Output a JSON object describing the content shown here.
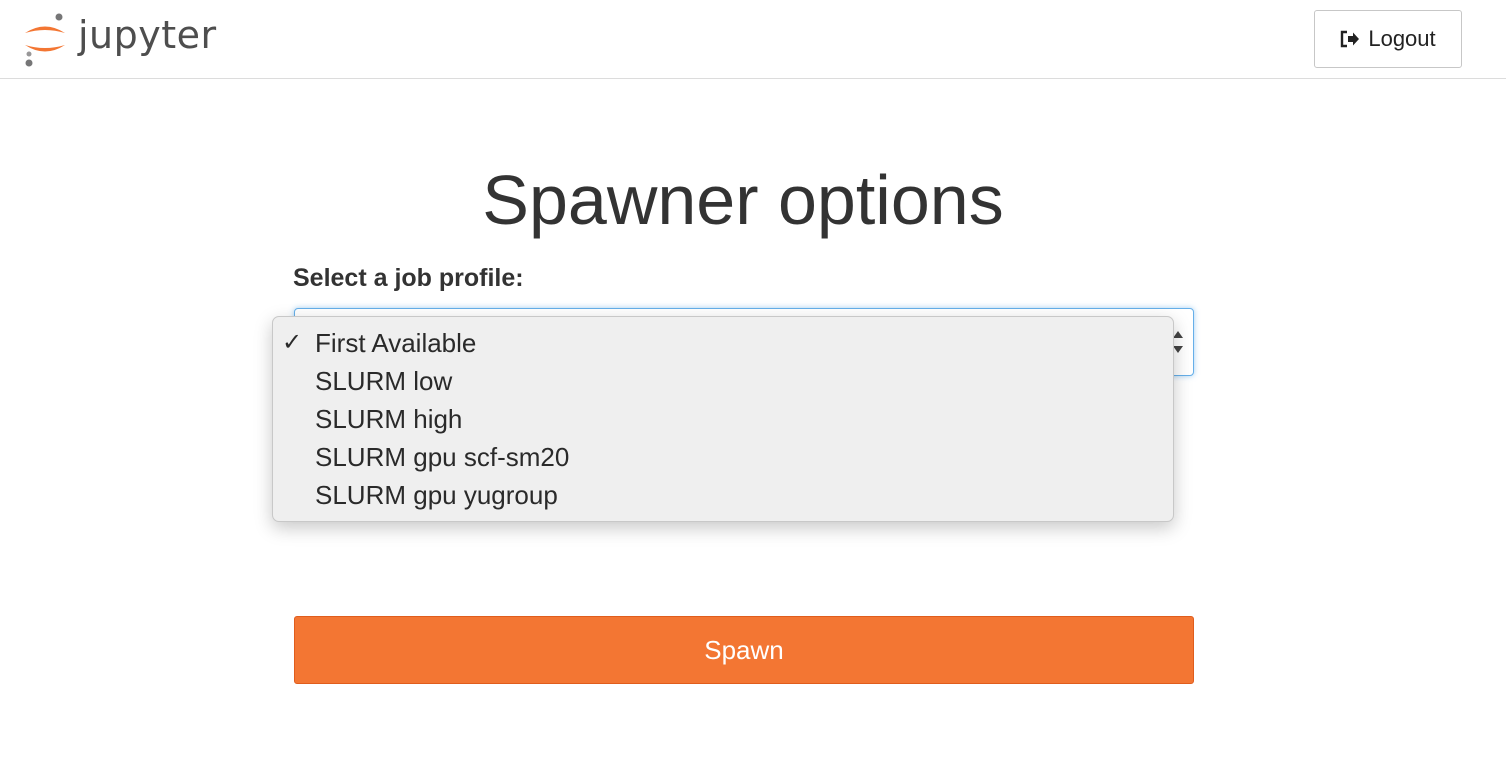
{
  "header": {
    "logo_text": "jupyter",
    "logout_label": "Logout"
  },
  "main": {
    "title": "Spawner options",
    "profile_label": "Select a job profile:",
    "profile_options": [
      {
        "label": "First Available",
        "selected": true
      },
      {
        "label": "SLURM low",
        "selected": false
      },
      {
        "label": "SLURM high",
        "selected": false
      },
      {
        "label": "SLURM gpu scf-sm20",
        "selected": false
      },
      {
        "label": "SLURM gpu yugroup",
        "selected": false
      }
    ],
    "selected_check": "✓",
    "spawn_label": "Spawn"
  },
  "colors": {
    "brand_orange": "#f37633",
    "focus_blue": "#66afe9"
  },
  "icons": {
    "logo": "jupyter-logo-icon",
    "logout": "sign-out-icon",
    "select_arrows": "select-updown-icon",
    "check": "checkmark-icon"
  }
}
